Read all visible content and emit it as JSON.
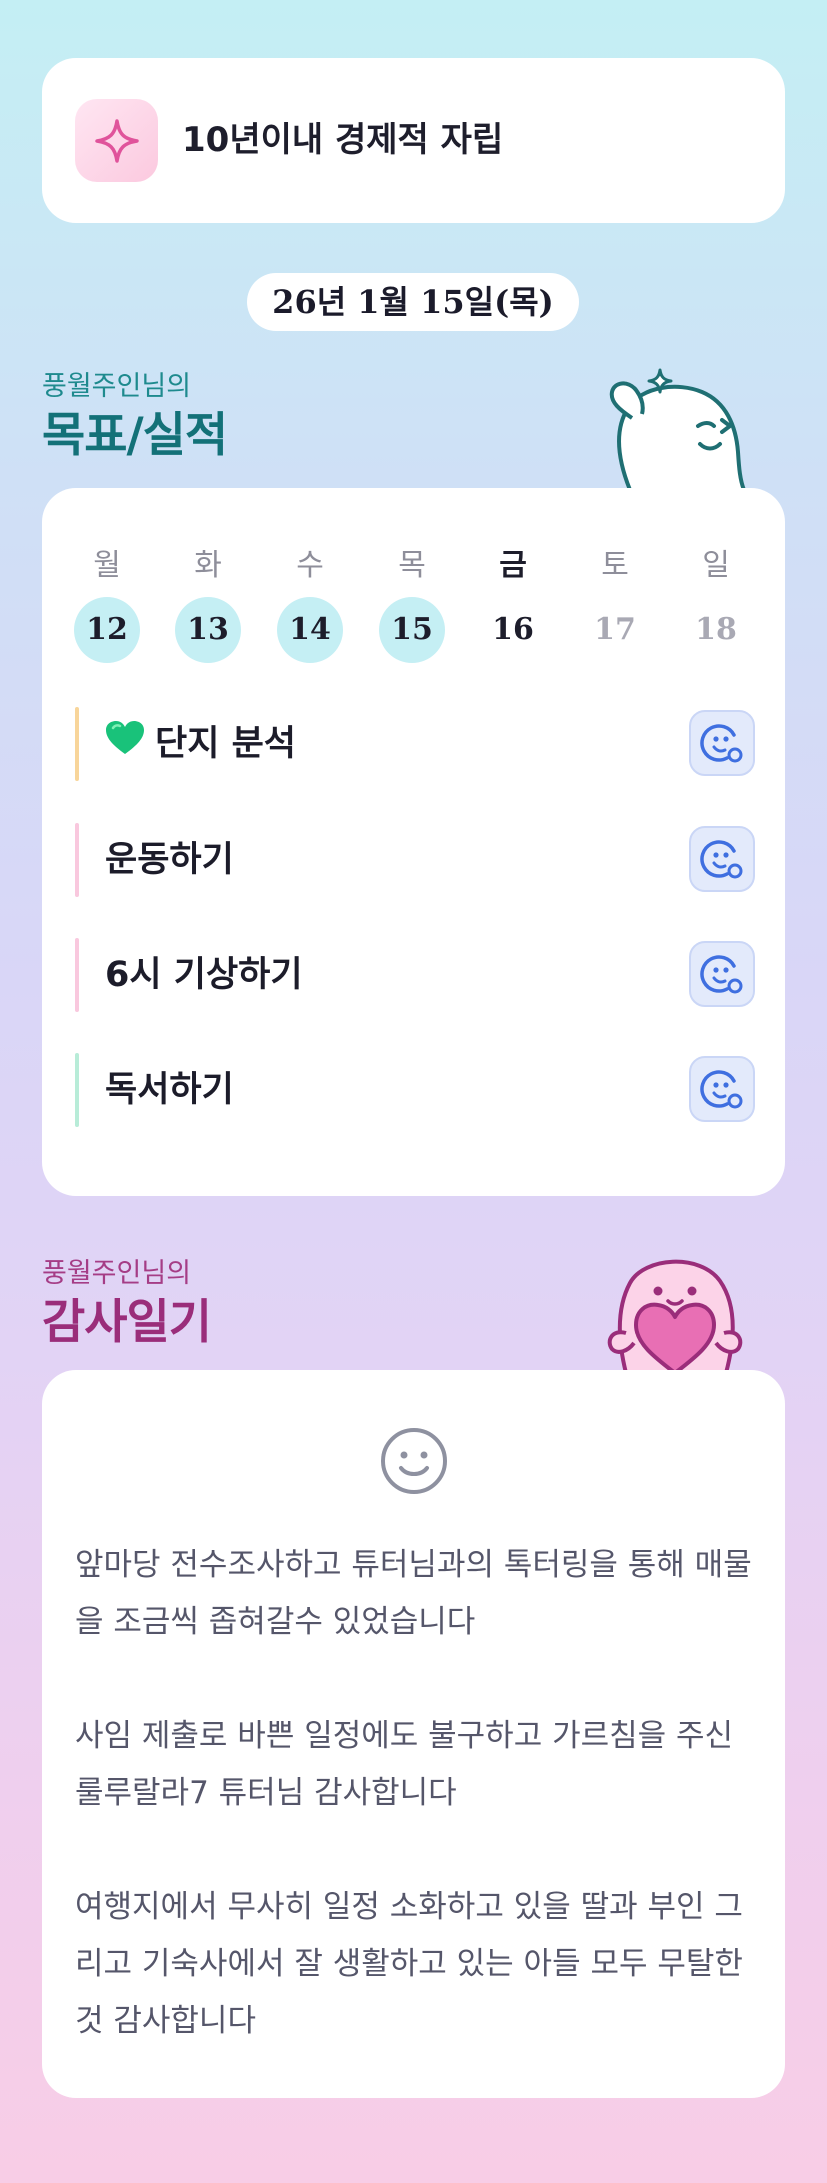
{
  "goal": {
    "icon": "sparkle-icon",
    "text": "10년이내 경제적 자립"
  },
  "date": "26년 1월 15일(목)",
  "goals_section": {
    "subtitle": "풍월주인님의",
    "title": "목표/실적",
    "mascot": "waving-character"
  },
  "week": {
    "days": [
      "월",
      "화",
      "수",
      "목",
      "금",
      "토",
      "일"
    ],
    "dates": [
      "12",
      "13",
      "14",
      "15",
      "16",
      "17",
      "18"
    ],
    "completed": [
      true,
      true,
      true,
      true,
      false,
      false,
      false
    ],
    "today_index": 4
  },
  "tasks": [
    {
      "label": "단지 분석",
      "emoji": "green-heart-icon",
      "bar_color": "#f8d59a"
    },
    {
      "label": "운동하기",
      "bar_color": "#f9c8de"
    },
    {
      "label": "6시 기상하기",
      "bar_color": "#f9c8de"
    },
    {
      "label": "독서하기",
      "bar_color": "#b8ecd8"
    }
  ],
  "gratitude_section": {
    "subtitle": "풍월주인님의",
    "title": "감사일기",
    "mascot": "heart-holding-character"
  },
  "diary": {
    "icon": "smile-icon",
    "paragraphs": [
      "앞마당 전수조사하고 튜터님과의 톡터링을 통해 매물을 조금씩 좁혀갈수 있었습니다",
      "사임 제출로 바쁜 일정에도 불구하고 가르침을 주신 룰루랄라7 튜터님 감사합니다",
      "여행지에서 무사히 일정 소화하고 있을 딸과 부인 그리고 기숙사에서 잘 생활하고 있는 아들 모두 무탈한 것 감사합니다"
    ]
  },
  "colors": {
    "accent_teal": "#1e8a8e",
    "accent_magenta": "#a53d86",
    "done_circle": "#c5eff4",
    "face_button": "#3f6fe0"
  }
}
